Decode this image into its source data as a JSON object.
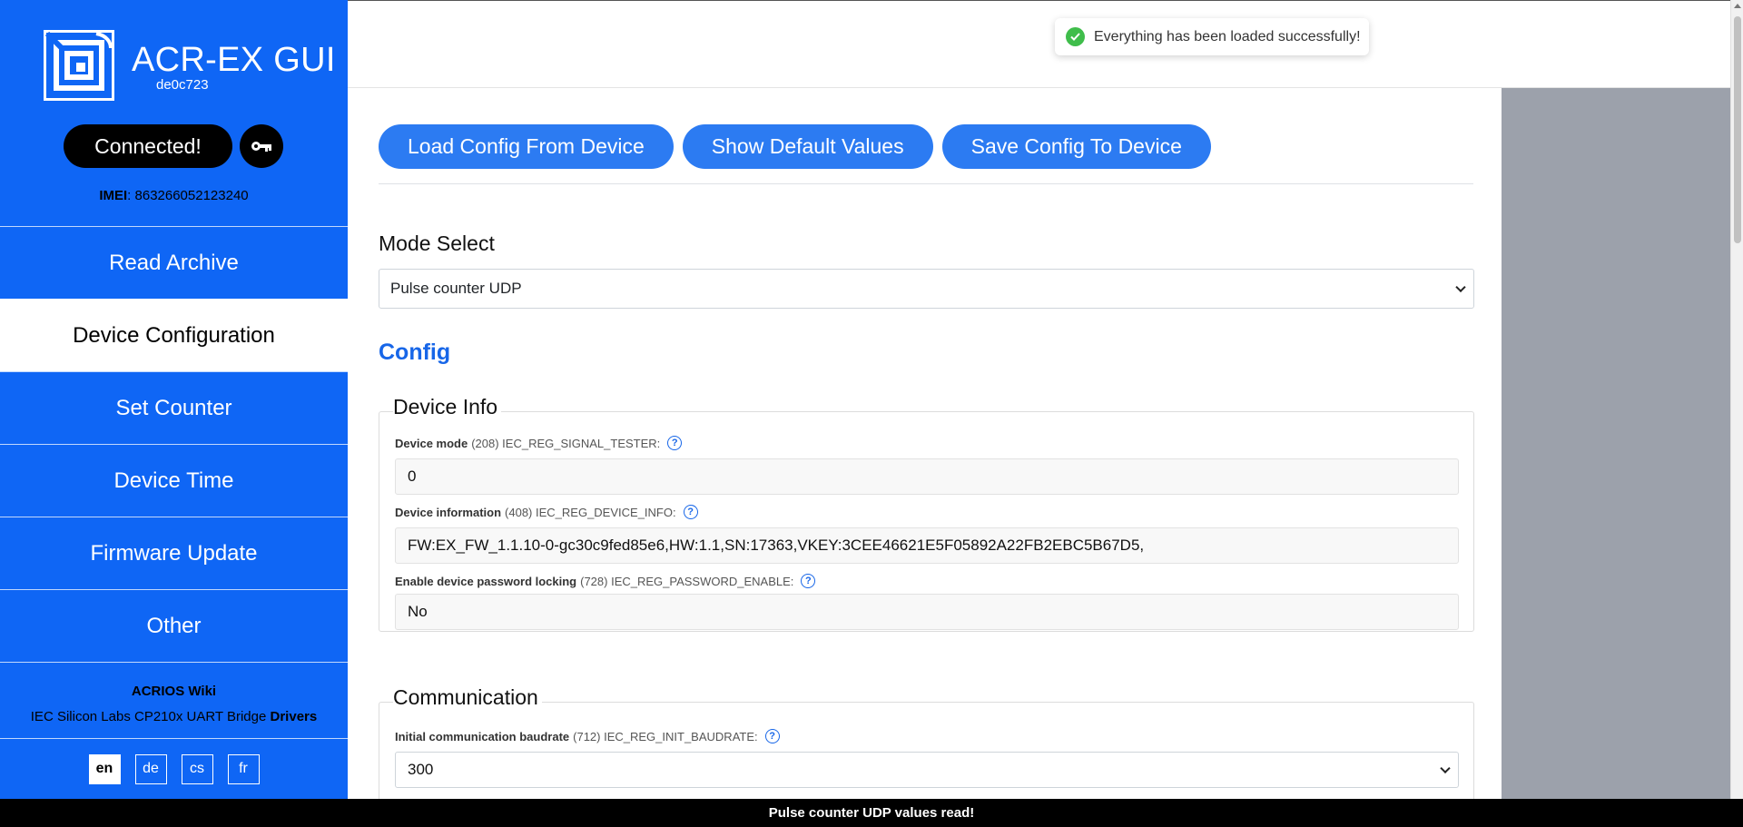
{
  "app": {
    "title": "ACR-EX GUI",
    "version": "de0c723",
    "connection_label": "Connected!",
    "imei_label": "IMEI",
    "imei_value": ": 863266052123240"
  },
  "sidebar": {
    "items": [
      {
        "label": "Read Archive",
        "active": false
      },
      {
        "label": "Device Configuration",
        "active": true
      },
      {
        "label": "Set Counter",
        "active": false
      },
      {
        "label": "Device Time",
        "active": false
      },
      {
        "label": "Firmware Update",
        "active": false
      },
      {
        "label": "Other",
        "active": false
      }
    ],
    "wiki_link": "ACRIOS Wiki",
    "drivers_prefix": "IEC Silicon Labs CP210x UART Bridge ",
    "drivers_link": "Drivers",
    "languages": [
      "en",
      "de",
      "cs",
      "fr"
    ],
    "active_language": "en"
  },
  "toast": {
    "message": "Everything has been loaded successfully!"
  },
  "toolbar": {
    "load_label": "Load Config From Device",
    "defaults_label": "Show Default Values",
    "save_label": "Save Config To Device"
  },
  "mode_select": {
    "label": "Mode Select",
    "value": "Pulse counter UDP"
  },
  "config_heading": "Config",
  "sections": {
    "device_info": {
      "legend": "Device Info",
      "fields": [
        {
          "name": "Device mode",
          "meta": "(208) IEC_REG_SIGNAL_TESTER:",
          "value": "0"
        },
        {
          "name": "Device information",
          "meta": "(408) IEC_REG_DEVICE_INFO:",
          "value": "FW:EX_FW_1.1.10-0-gc30c9fed85e6,HW:1.1,SN:17363,VKEY:3CEE46621E5F05892A22FB2EBC5B67D5,"
        },
        {
          "name": "Enable device password locking",
          "meta": "(728) IEC_REG_PASSWORD_ENABLE:",
          "value": "No"
        }
      ]
    },
    "communication": {
      "legend": "Communication",
      "fields": [
        {
          "name": "Initial communication baudrate",
          "meta": "(712) IEC_REG_INIT_BAUDRATE:",
          "value": "300"
        }
      ]
    }
  },
  "help_glyph": "?",
  "status_bar": {
    "message": "Pulse counter UDP values read!"
  },
  "colors": {
    "sidebar_bg": "#0f66f5",
    "button_bg": "#2c7bf2",
    "accent": "#1766e8",
    "success": "#3fbd4b",
    "gutter": "#9ca1ab"
  }
}
